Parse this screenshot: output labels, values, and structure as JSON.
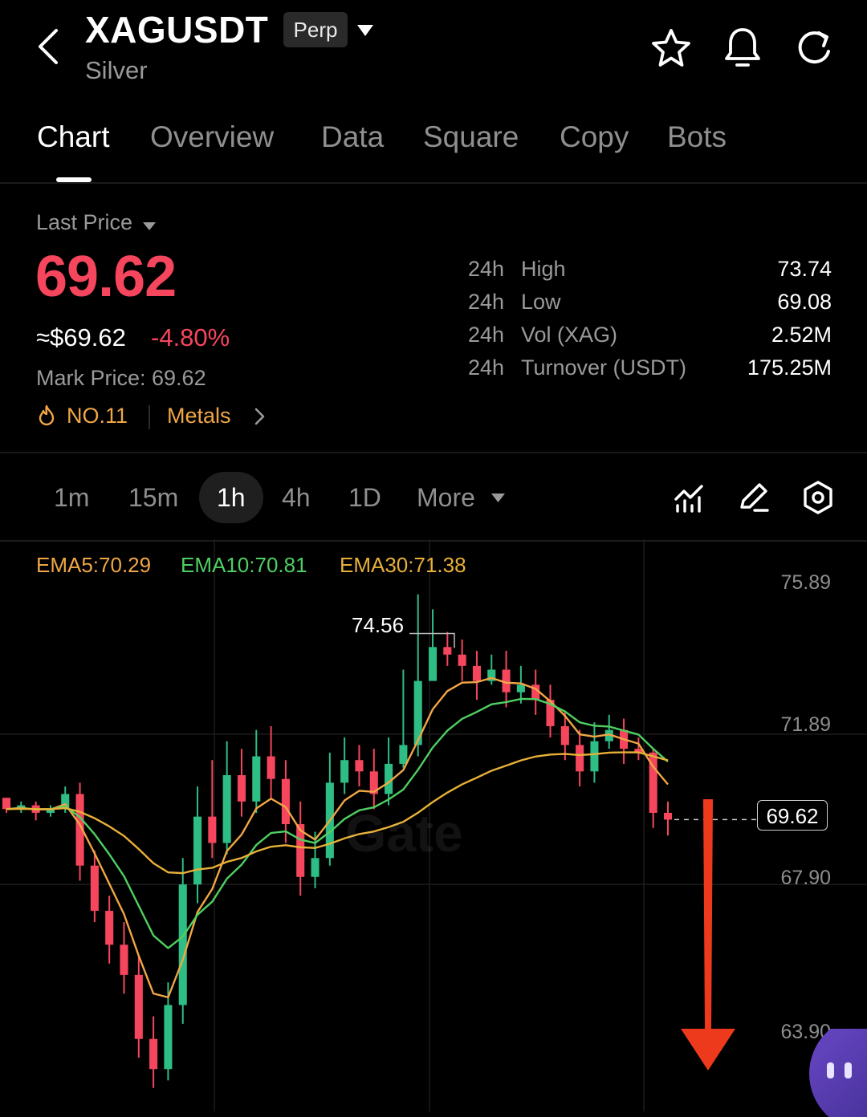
{
  "header": {
    "symbol": "XAGUSDT",
    "contract_type": "Perp",
    "asset_name": "Silver",
    "icons": [
      "back-arrow",
      "star",
      "bell",
      "refresh"
    ]
  },
  "tabs": [
    {
      "label": "Chart",
      "active": true
    },
    {
      "label": "Overview",
      "active": false
    },
    {
      "label": "Data",
      "active": false
    },
    {
      "label": "Square",
      "active": false
    },
    {
      "label": "Copy",
      "active": false
    },
    {
      "label": "Bots",
      "active": false
    }
  ],
  "price": {
    "price_type_label": "Last Price",
    "last_price": "69.62",
    "approx_value": "≈$69.62",
    "change_pct": "-4.80%",
    "mark_price": "Mark Price: 69.62",
    "rank": "NO.11",
    "category": "Metals"
  },
  "stats": [
    {
      "period": "24h",
      "name": "High",
      "value": "73.74"
    },
    {
      "period": "24h",
      "name": "Low",
      "value": "69.08"
    },
    {
      "period": "24h",
      "name": "Vol (XAG)",
      "value": "2.52M"
    },
    {
      "period": "24h",
      "name": "Turnover (USDT)",
      "value": "175.25M"
    }
  ],
  "intervals": [
    {
      "label": "1m",
      "active": false
    },
    {
      "label": "15m",
      "active": false
    },
    {
      "label": "1h",
      "active": true
    },
    {
      "label": "4h",
      "active": false
    },
    {
      "label": "1D",
      "active": false
    },
    {
      "label": "More",
      "active": false
    }
  ],
  "chart_tools": [
    "indicators-icon",
    "draw-icon",
    "settings-icon"
  ],
  "chart_overlay": {
    "ema5": "EMA5:70.29",
    "ema10": "EMA10:70.81",
    "ema30": "EMA30:71.38",
    "peak_label": "74.56",
    "current_price_tag": "69.62",
    "watermark": "Gate"
  },
  "colors": {
    "up": "#2ebd85",
    "down": "#f6465d",
    "ema5": "#f0a646",
    "ema10": "#4fcf62",
    "ema30": "#e8b038",
    "accent": "#f0a646",
    "arrow": "#ee3a1c"
  },
  "chart_data": {
    "type": "candlestick",
    "interval": "1h",
    "y_axis_labels": [
      "75.89",
      "71.89",
      "67.90",
      "63.90"
    ],
    "ylim": [
      62.4,
      76.5
    ],
    "grid": true,
    "candles": [
      [
        70.2,
        69.9,
        70.0,
        69.8
      ],
      [
        69.9,
        70.0,
        70.1,
        69.8
      ],
      [
        70.0,
        69.8,
        70.1,
        69.6
      ],
      [
        69.8,
        69.9,
        70.0,
        69.7
      ],
      [
        69.9,
        70.3,
        70.5,
        69.8
      ],
      [
        70.3,
        68.4,
        70.6,
        68.0
      ],
      [
        68.4,
        67.2,
        68.8,
        66.9
      ],
      [
        67.2,
        66.3,
        67.6,
        65.8
      ],
      [
        66.3,
        65.5,
        66.9,
        65.0
      ],
      [
        65.5,
        63.8,
        66.0,
        63.3
      ],
      [
        63.8,
        63.0,
        64.4,
        62.5
      ],
      [
        63.0,
        64.7,
        65.3,
        62.7
      ],
      [
        64.7,
        67.9,
        68.6,
        64.2
      ],
      [
        67.9,
        69.7,
        70.5,
        67.4
      ],
      [
        69.7,
        69.0,
        71.2,
        68.6
      ],
      [
        69.0,
        70.8,
        71.7,
        68.7
      ],
      [
        70.8,
        70.1,
        71.5,
        69.7
      ],
      [
        70.1,
        71.3,
        72.0,
        69.8
      ],
      [
        71.3,
        70.7,
        72.1,
        70.2
      ],
      [
        70.7,
        69.5,
        71.2,
        69.0
      ],
      [
        69.5,
        68.1,
        70.1,
        67.6
      ],
      [
        68.1,
        68.6,
        69.3,
        67.8
      ],
      [
        68.6,
        70.6,
        71.4,
        68.4
      ],
      [
        70.6,
        71.2,
        71.8,
        70.3
      ],
      [
        71.2,
        70.9,
        71.6,
        70.5
      ],
      [
        70.9,
        70.3,
        71.5,
        69.9
      ],
      [
        70.3,
        71.1,
        71.8,
        70.0
      ],
      [
        71.1,
        71.6,
        73.6,
        71.0
      ],
      [
        71.6,
        73.3,
        75.6,
        71.3
      ],
      [
        73.3,
        74.2,
        75.2,
        73.4
      ],
      [
        74.2,
        74.0,
        74.6,
        73.7
      ],
      [
        74.0,
        73.7,
        74.4,
        73.3
      ],
      [
        73.7,
        73.3,
        74.1,
        72.8
      ],
      [
        73.3,
        73.6,
        74.0,
        73.2
      ],
      [
        73.6,
        73.0,
        74.1,
        72.6
      ],
      [
        73.0,
        73.2,
        73.7,
        72.7
      ],
      [
        73.2,
        72.8,
        73.6,
        72.4
      ],
      [
        72.8,
        72.1,
        73.2,
        71.8
      ],
      [
        72.1,
        71.6,
        72.5,
        71.2
      ],
      [
        71.6,
        70.9,
        72.0,
        70.5
      ],
      [
        70.9,
        71.7,
        72.2,
        70.6
      ],
      [
        71.7,
        72.0,
        72.4,
        71.5
      ],
      [
        72.0,
        71.5,
        72.3,
        71.1
      ],
      [
        71.5,
        71.4,
        71.8,
        71.2
      ],
      [
        71.4,
        69.8,
        71.5,
        69.4
      ],
      [
        69.8,
        69.62,
        70.1,
        69.2
      ]
    ],
    "ema_series": [
      {
        "name": "EMA5",
        "last": 70.29
      },
      {
        "name": "EMA10",
        "last": 70.81
      },
      {
        "name": "EMA30",
        "last": 71.38
      }
    ],
    "annotations": [
      {
        "label": "74.56",
        "kind": "period-high"
      },
      {
        "label": "69.62",
        "kind": "current-price"
      }
    ]
  }
}
